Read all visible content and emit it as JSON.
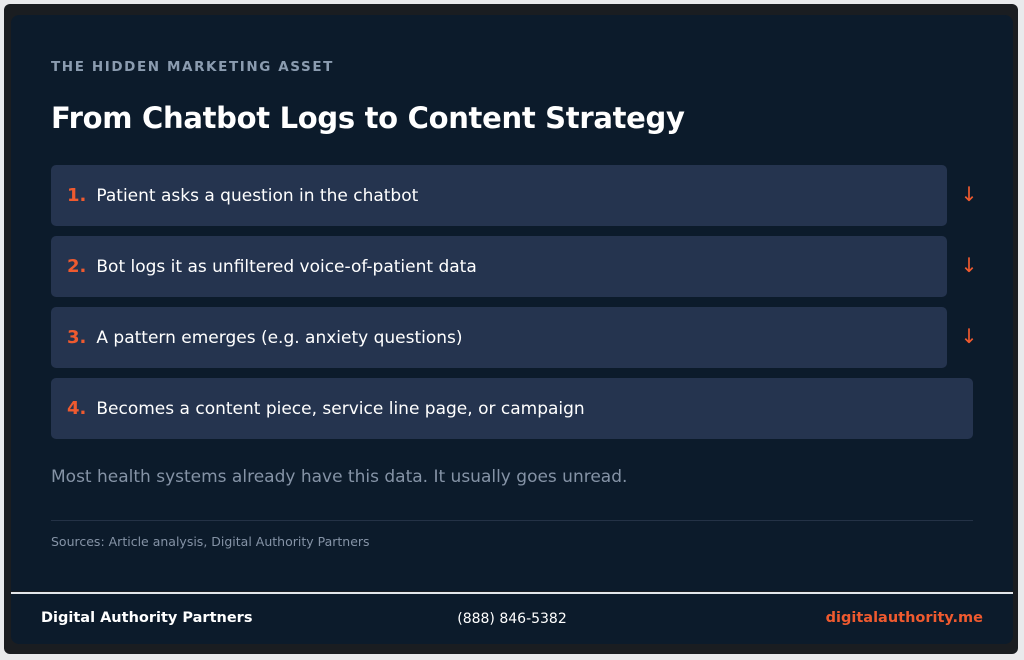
{
  "header": {
    "eyebrow": "THE HIDDEN MARKETING ASSET",
    "title": "From Chatbot Logs to Content Strategy"
  },
  "steps": [
    {
      "number": "1.",
      "text": "Patient asks a question in the chatbot",
      "arrow": "↓"
    },
    {
      "number": "2.",
      "text": "Bot logs it as unfiltered voice-of-patient data",
      "arrow": "↓"
    },
    {
      "number": "3.",
      "text": "A pattern emerges (e.g. anxiety questions)",
      "arrow": "↓"
    },
    {
      "number": "4.",
      "text": "Becomes a content piece, service line page, or campaign"
    }
  ],
  "note": "Most health systems already have this data. It usually goes unread.",
  "sources": "Sources: Article analysis, Digital Authority Partners",
  "footer": {
    "company": "Digital Authority Partners",
    "phone": "(888) 846-5382",
    "website": "digitalauthority.me"
  },
  "colors": {
    "background": "#0c1b2b",
    "step_box": "#25344f",
    "accent": "#ef5a2f",
    "muted_text": "#8593a6"
  }
}
